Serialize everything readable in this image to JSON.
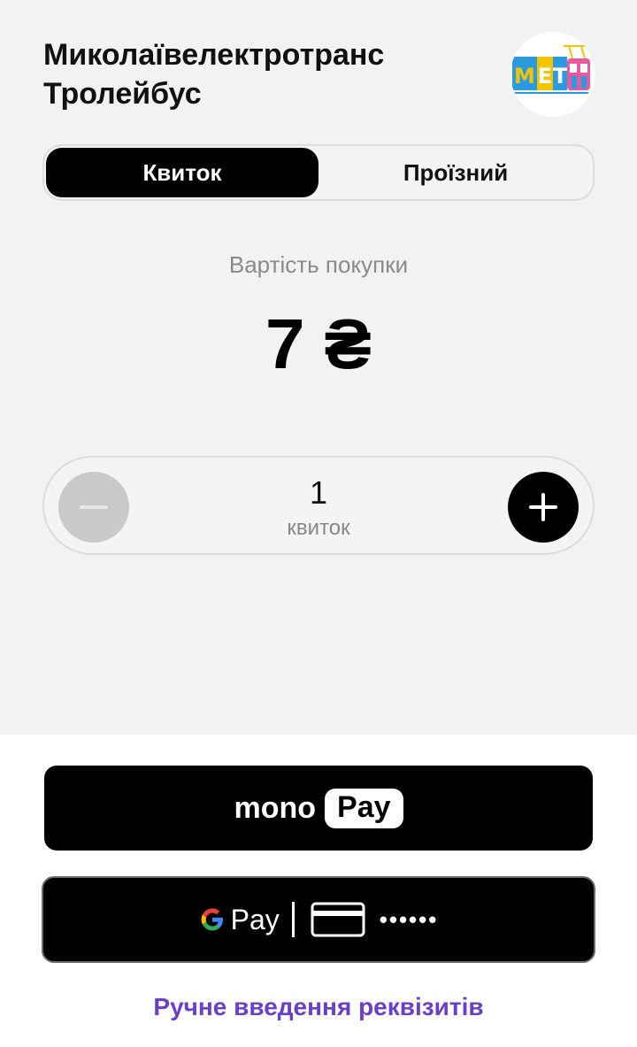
{
  "header": {
    "title_line1": "Миколаївелектротранс",
    "title_line2": "Тролейбус",
    "logo_icon": "trolleybus-logo-icon"
  },
  "tabs": [
    {
      "label": "Квиток",
      "active": true
    },
    {
      "label": "Проїзний",
      "active": false
    }
  ],
  "price": {
    "label": "Вартість покупки",
    "value": "7 ₴"
  },
  "stepper": {
    "quantity": "1",
    "unit": "квиток"
  },
  "payment": {
    "monopay_word": "mono",
    "monopay_chip": "Pay",
    "gpay_label": "Pay",
    "card_mask": "••••••",
    "manual_link": "Ручне введення реквізитів"
  },
  "colors": {
    "background": "#f2f2f2",
    "accent_link": "#6a3fc9",
    "primary": "#000000",
    "minus_disabled": "#c9c9c9"
  }
}
